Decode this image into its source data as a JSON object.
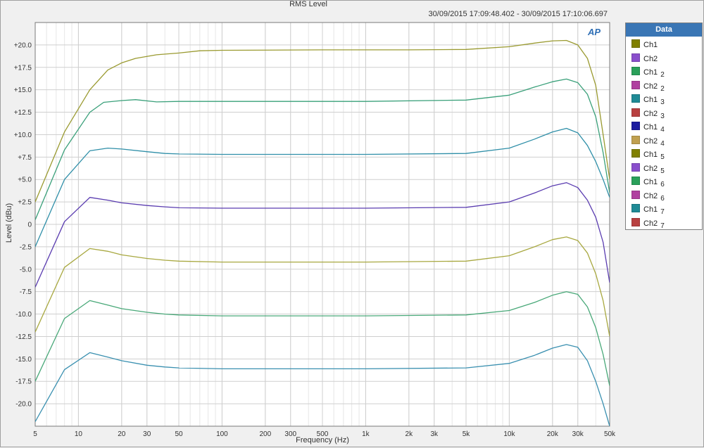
{
  "chart_data": {
    "type": "line",
    "title": "RMS Level",
    "subtitle": "30/09/2015 17:09:48.402 - 30/09/2015 17:10:06.697",
    "xlabel": "Frequency (Hz)",
    "ylabel": "Level (dBu)",
    "xscale": "log",
    "xlim": [
      5,
      50000
    ],
    "ylim": [
      -22.5,
      22.5
    ],
    "x_ticks": [
      5,
      10,
      20,
      30,
      50,
      100,
      200,
      300,
      500,
      1000,
      2000,
      3000,
      5000,
      10000,
      20000,
      30000,
      50000
    ],
    "x_tick_labels": [
      "5",
      "10",
      "20",
      "30",
      "50",
      "100",
      "200",
      "300",
      "500",
      "1k",
      "2k",
      "3k",
      "5k",
      "10k",
      "20k",
      "30k",
      "50k"
    ],
    "y_ticks": [
      20,
      17.5,
      15,
      12.5,
      10,
      7.5,
      5,
      2.5,
      0,
      -2.5,
      -5,
      -7.5,
      -10,
      -12.5,
      -15,
      -17.5,
      -20
    ],
    "y_tick_labels": [
      "+20.0",
      "+17.5",
      "+15.0",
      "+12.5",
      "+10.0",
      "+7.5",
      "+5.0",
      "+2.5",
      "0",
      "-2.5",
      "-5.0",
      "-7.5",
      "-10.0",
      "-12.5",
      "-15.0",
      "-17.5",
      "-20.0"
    ],
    "grid": true,
    "legend_position": "right",
    "legend_title": "Data",
    "legend": [
      {
        "label": "Ch1",
        "sub": "",
        "color": "#808000"
      },
      {
        "label": "Ch2",
        "sub": "",
        "color": "#8a4fcc"
      },
      {
        "label": "Ch1",
        "sub": "2",
        "color": "#2aa05a"
      },
      {
        "label": "Ch2",
        "sub": "2",
        "color": "#b040a0"
      },
      {
        "label": "Ch1",
        "sub": "3",
        "color": "#1f8a95"
      },
      {
        "label": "Ch2",
        "sub": "3",
        "color": "#b84040"
      },
      {
        "label": "Ch1",
        "sub": "4",
        "color": "#1c1ca0"
      },
      {
        "label": "Ch2",
        "sub": "4",
        "color": "#c0a050"
      },
      {
        "label": "Ch1",
        "sub": "5",
        "color": "#808000"
      },
      {
        "label": "Ch2",
        "sub": "5",
        "color": "#8a4fcc"
      },
      {
        "label": "Ch1",
        "sub": "6",
        "color": "#2aa05a"
      },
      {
        "label": "Ch2",
        "sub": "6",
        "color": "#b040a0"
      },
      {
        "label": "Ch1",
        "sub": "7",
        "color": "#1f8a95"
      },
      {
        "label": "Ch2",
        "sub": "7",
        "color": "#b84040"
      }
    ],
    "series": [
      {
        "color": "#9a9a30",
        "points": [
          [
            5,
            2.5
          ],
          [
            8,
            10.3
          ],
          [
            12,
            15.0
          ],
          [
            16,
            17.2
          ],
          [
            20,
            18.0
          ],
          [
            25,
            18.5
          ],
          [
            35,
            18.9
          ],
          [
            50,
            19.1
          ],
          [
            70,
            19.35
          ],
          [
            100,
            19.4
          ],
          [
            500,
            19.45
          ],
          [
            2000,
            19.45
          ],
          [
            5000,
            19.5
          ],
          [
            10000,
            19.8
          ],
          [
            15000,
            20.2
          ],
          [
            20000,
            20.45
          ],
          [
            25000,
            20.5
          ],
          [
            30000,
            20.0
          ],
          [
            35000,
            18.5
          ],
          [
            40000,
            15.5
          ],
          [
            45000,
            10.0
          ],
          [
            50000,
            5.0
          ]
        ]
      },
      {
        "color": "#3aa07a",
        "points": [
          [
            5,
            0.5
          ],
          [
            8,
            8.3
          ],
          [
            12,
            12.5
          ],
          [
            15,
            13.6
          ],
          [
            20,
            13.8
          ],
          [
            25,
            13.9
          ],
          [
            35,
            13.65
          ],
          [
            50,
            13.7
          ],
          [
            100,
            13.7
          ],
          [
            1000,
            13.7
          ],
          [
            5000,
            13.85
          ],
          [
            10000,
            14.4
          ],
          [
            15000,
            15.3
          ],
          [
            20000,
            15.9
          ],
          [
            25000,
            16.2
          ],
          [
            30000,
            15.8
          ],
          [
            35000,
            14.5
          ],
          [
            40000,
            12.0
          ],
          [
            45000,
            8.0
          ],
          [
            50000,
            3.5
          ]
        ]
      },
      {
        "color": "#2f8fa8",
        "points": [
          [
            5,
            -2.5
          ],
          [
            8,
            5.0
          ],
          [
            12,
            8.2
          ],
          [
            16,
            8.5
          ],
          [
            20,
            8.4
          ],
          [
            30,
            8.1
          ],
          [
            40,
            7.9
          ],
          [
            50,
            7.85
          ],
          [
            100,
            7.8
          ],
          [
            1000,
            7.8
          ],
          [
            5000,
            7.9
          ],
          [
            10000,
            8.5
          ],
          [
            15000,
            9.5
          ],
          [
            20000,
            10.3
          ],
          [
            25000,
            10.7
          ],
          [
            30000,
            10.2
          ],
          [
            35000,
            8.8
          ],
          [
            40000,
            7.0
          ],
          [
            45000,
            5.0
          ],
          [
            50000,
            3.0
          ]
        ]
      },
      {
        "color": "#5a3cb0",
        "points": [
          [
            5,
            -7.0
          ],
          [
            8,
            0.3
          ],
          [
            12,
            3.0
          ],
          [
            16,
            2.7
          ],
          [
            20,
            2.4
          ],
          [
            30,
            2.1
          ],
          [
            40,
            1.95
          ],
          [
            50,
            1.85
          ],
          [
            100,
            1.8
          ],
          [
            1000,
            1.8
          ],
          [
            5000,
            1.9
          ],
          [
            10000,
            2.5
          ],
          [
            15000,
            3.5
          ],
          [
            20000,
            4.3
          ],
          [
            25000,
            4.65
          ],
          [
            30000,
            4.1
          ],
          [
            35000,
            2.7
          ],
          [
            40000,
            0.8
          ],
          [
            45000,
            -2.0
          ],
          [
            50000,
            -6.5
          ]
        ]
      },
      {
        "color": "#a8a840",
        "points": [
          [
            5,
            -12.0
          ],
          [
            8,
            -4.8
          ],
          [
            12,
            -2.7
          ],
          [
            16,
            -3.0
          ],
          [
            20,
            -3.4
          ],
          [
            30,
            -3.8
          ],
          [
            40,
            -4.0
          ],
          [
            50,
            -4.1
          ],
          [
            100,
            -4.2
          ],
          [
            1000,
            -4.2
          ],
          [
            5000,
            -4.1
          ],
          [
            10000,
            -3.5
          ],
          [
            15000,
            -2.5
          ],
          [
            20000,
            -1.7
          ],
          [
            25000,
            -1.4
          ],
          [
            30000,
            -1.8
          ],
          [
            35000,
            -3.2
          ],
          [
            40000,
            -5.5
          ],
          [
            45000,
            -8.5
          ],
          [
            50000,
            -12.5
          ]
        ]
      },
      {
        "color": "#48a878",
        "points": [
          [
            5,
            -17.5
          ],
          [
            8,
            -10.5
          ],
          [
            12,
            -8.5
          ],
          [
            16,
            -9.0
          ],
          [
            20,
            -9.4
          ],
          [
            30,
            -9.8
          ],
          [
            40,
            -10.0
          ],
          [
            50,
            -10.1
          ],
          [
            100,
            -10.2
          ],
          [
            1000,
            -10.2
          ],
          [
            5000,
            -10.1
          ],
          [
            10000,
            -9.6
          ],
          [
            15000,
            -8.7
          ],
          [
            20000,
            -7.9
          ],
          [
            25000,
            -7.5
          ],
          [
            30000,
            -7.8
          ],
          [
            35000,
            -9.2
          ],
          [
            40000,
            -11.5
          ],
          [
            45000,
            -14.5
          ],
          [
            50000,
            -18.0
          ]
        ]
      },
      {
        "color": "#3a90b0",
        "points": [
          [
            5,
            -22.0
          ],
          [
            8,
            -16.2
          ],
          [
            12,
            -14.3
          ],
          [
            16,
            -14.8
          ],
          [
            20,
            -15.2
          ],
          [
            30,
            -15.7
          ],
          [
            40,
            -15.9
          ],
          [
            50,
            -16.0
          ],
          [
            100,
            -16.1
          ],
          [
            1000,
            -16.1
          ],
          [
            5000,
            -16.0
          ],
          [
            10000,
            -15.5
          ],
          [
            15000,
            -14.6
          ],
          [
            20000,
            -13.8
          ],
          [
            25000,
            -13.4
          ],
          [
            30000,
            -13.7
          ],
          [
            35000,
            -15.2
          ],
          [
            40000,
            -17.5
          ],
          [
            45000,
            -20.0
          ],
          [
            50000,
            -22.5
          ]
        ]
      }
    ]
  }
}
